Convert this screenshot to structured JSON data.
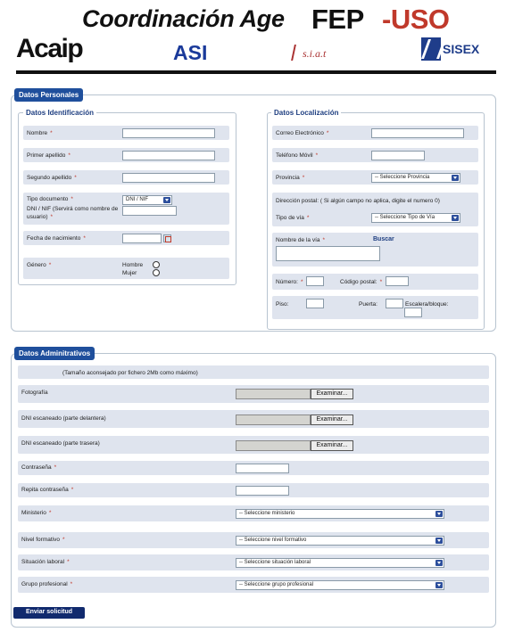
{
  "header": {
    "title_prefix": "Coordinación Age",
    "fep": "FEP",
    "uso": "-USO",
    "logos": {
      "acaip": "Acaip",
      "asi": "ASI",
      "siat": "s.i.a.t",
      "sisex": "SISEX"
    }
  },
  "personal": {
    "legend": "Datos Personales",
    "identificacion": {
      "legend": "Datos Identificación",
      "nombre": "Nombre",
      "primer_apellido": "Primer apellido",
      "segundo_apellido": "Segundo apellido",
      "tipo_documento": "Tipo documento",
      "tipo_documento_value": "DNI / NIF",
      "dni_label": "DNI / NIF (Servirá como nombre de usuario)",
      "fecha_nacimiento": "Fecha de nacimiento",
      "genero": "Género",
      "hombre": "Hombre",
      "mujer": "Mujer"
    },
    "localizacion": {
      "legend": "Datos Localización",
      "correo": "Correo Electrónico",
      "telefono": "Teléfono Móvil",
      "provincia": "Provincia",
      "provincia_value": "-- Seleccione Provincia",
      "direccion_note": "Dirección postal: ( Si algún campo no aplica, digite el numero 0)",
      "tipo_via": "Tipo de vía",
      "tipo_via_value": "-- Seleccione Tipo de Vía",
      "nombre_via": "Nombre de la vía",
      "buscar": "Buscar",
      "numero": "Número:",
      "codigo_postal": "Código postal:",
      "piso": "Piso:",
      "puerta": "Puerta:",
      "escalera": "Escalera/bloque:"
    }
  },
  "admin": {
    "legend": "Datos Adminitrativos",
    "note": "(Tamaño aconsejado por fichero 2Mb como máximo)",
    "fotografia": "Fotografía",
    "dni_delantera": "DNI escaneado (parte delantera)",
    "dni_trasera": "DNI escaneado (parte trasera)",
    "examinar": "Examinar...",
    "contrasena": "Contraseña",
    "repita": "Repita contraseña",
    "ministerio": "Ministerio",
    "ministerio_value": "-- Seleccione ministerio",
    "nivel": "Nivel formativo",
    "nivel_value": "-- Seleccione nivel formativo",
    "situacion": "Situación laboral",
    "situacion_value": "-- Seleccione situación laboral",
    "grupo": "Grupo profesional",
    "grupo_value": "-- Seleccione grupo profesional"
  },
  "submit": "Enviar solicitud",
  "required_mark": "*"
}
